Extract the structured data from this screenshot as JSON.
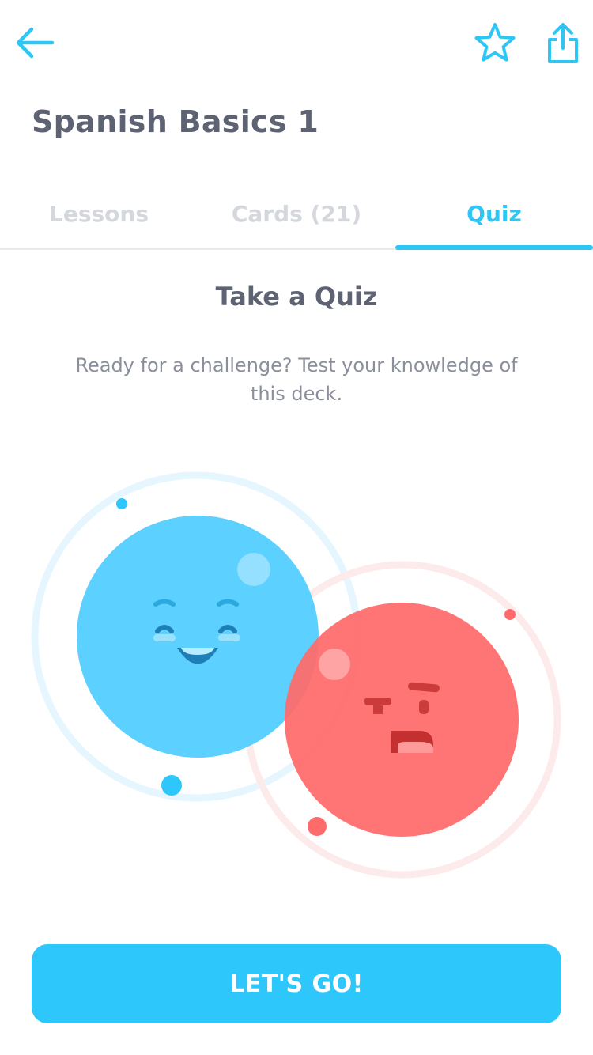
{
  "header": {
    "back_icon": "arrow-left-icon",
    "favorite_icon": "star-outline-icon",
    "share_icon": "share-icon",
    "accent_color": "#2ec7f5"
  },
  "deck": {
    "title": "Spanish Basics 1"
  },
  "tabs": [
    {
      "label": "Lessons",
      "active": false
    },
    {
      "label": "Cards (21)",
      "active": false
    },
    {
      "label": "Quiz",
      "active": true
    }
  ],
  "quiz": {
    "heading": "Take a Quiz",
    "description": "Ready for a challenge? Test your knowledge of this deck."
  },
  "illustration": {
    "happy_character_color": "#5cd0fe",
    "grumpy_character_color": "#ff6b6b"
  },
  "cta": {
    "label": "LET'S GO!",
    "color": "#2ec7fb"
  }
}
